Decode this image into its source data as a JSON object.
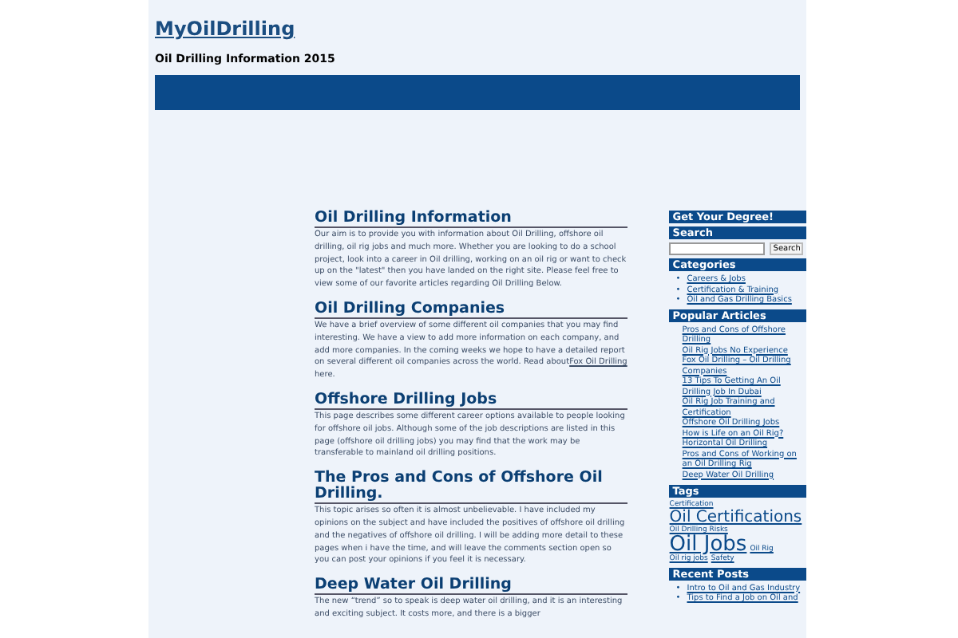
{
  "header": {
    "title": "MyOilDrilling",
    "tagline": "Oil Drilling Information 2015"
  },
  "posts": [
    {
      "title": "Oil Drilling Information",
      "body": "Our aim is to provide you with information about Oil Drilling, offshore oil drilling, oil rig jobs and much more. Whether you are looking to do a school project, look into a career in Oil drilling, working on an oil rig or want to check up on the \"latest\" then you have landed on the right site. Please feel free to view some of our favorite articles regarding Oil Drilling Below."
    },
    {
      "title": "Oil Drilling Companies",
      "body": "We have a brief overview of some different oil companies that you may find interesting. We have a view to add more information on each company, and add more companies. In the coming weeks we hope to have a detailed report on several different oil companies across the world. Read about",
      "link": "Fox Oil Drilling",
      "after": "here."
    },
    {
      "title": "Offshore Drilling Jobs",
      "body": "This page describes some different career options available to people looking for offshore oil jobs. Although some of the job descriptions are listed in this page (offshore oil drilling jobs) you may find that the work may be transferable to mainland oil drilling positions."
    },
    {
      "title": "The Pros and Cons of Offshore Oil Drilling.",
      "body": "This topic arises so often it is almost unbelievable. I have included my opinions on the subject and have included the positives of offshore oil drilling and the negatives of offshore oil drilling. I will be adding more detail to these pages when i have the time, and will leave the comments section open so you can post your opinions if you feel it is necessary."
    },
    {
      "title": "Deep Water Oil Drilling",
      "body": "The new “trend” so to speak is deep water oil drilling, and it is an interesting and exciting subject. It costs more, and there is a bigger"
    }
  ],
  "sidebar": {
    "degree_heading": "Get Your Degree!",
    "search_heading": "Search",
    "search_button": "Search",
    "categories_heading": "Categories",
    "bullet": "•",
    "categories": [
      "Careers & Jobs",
      "Certification & Training",
      "Oil and Gas Drilling Basics"
    ],
    "popular_heading": "Popular Articles",
    "popular": [
      "Pros and Cons of Offshore Drilling",
      "Oil Rig Jobs No Experience",
      "Fox Oil Drilling – Oil Drilling Companies",
      "13 Tips To Getting An Oil Drilling Job In Dubai",
      "Oil Rig Job Training and Certification",
      "Offshore Oil Drilling Jobs",
      "How is Life on an Oil Rig?",
      "Horizontal Oil Drilling",
      "Pros and Cons of Working on an Oil Drilling Rig",
      "Deep Water Oil Drilling"
    ],
    "tags_heading": "Tags",
    "tags": [
      {
        "label": "Certification",
        "kind": "small"
      },
      {
        "label": "Oil Certifications",
        "kind": "medium"
      },
      {
        "label": "Oil Drilling Risks",
        "kind": "small"
      },
      {
        "label": "Oil Jobs",
        "kind": "large"
      },
      {
        "label": "Oil Rig",
        "kind": "small"
      },
      {
        "label": "Oil rig jobs",
        "kind": "small"
      },
      {
        "label": "Safety",
        "kind": "small"
      }
    ],
    "recent_heading": "Recent Posts",
    "recent": [
      "Intro to Oil and Gas Industry",
      "Tips to Find a Job on Oil and"
    ]
  }
}
